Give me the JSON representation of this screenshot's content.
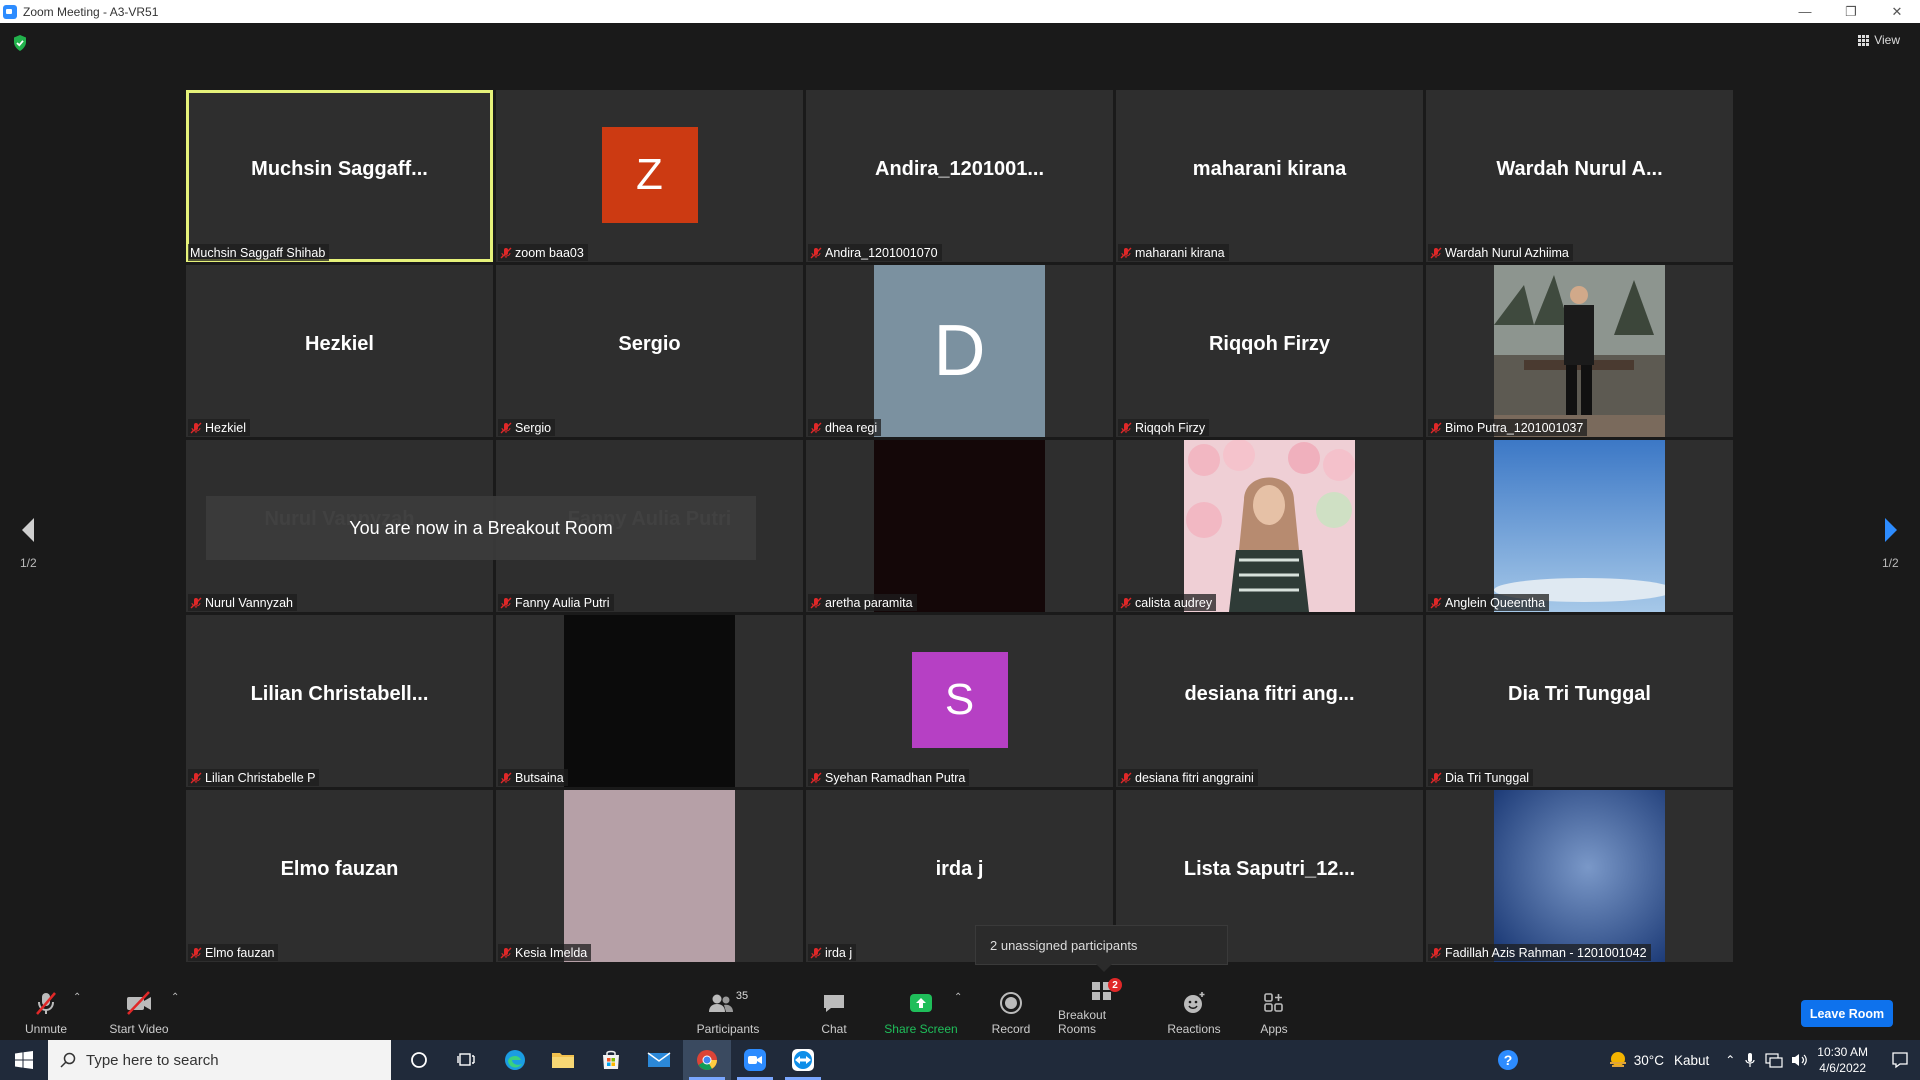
{
  "window": {
    "title": "Zoom Meeting - A3-VR51"
  },
  "top": {
    "view_label": "View"
  },
  "banner": {
    "text": "You are now in a Breakout Room"
  },
  "pager": {
    "left": "1/2",
    "right": "1/2"
  },
  "tiles": [
    {
      "big": "Muchsin  Saggaff...",
      "label": "Muchsin Saggaff Shihab",
      "muted": false,
      "active": true
    },
    {
      "avatar_letter": "Z",
      "avatar_color": "#cc3a12",
      "label": "zoom baa03",
      "muted": true
    },
    {
      "big": "Andira_1201001...",
      "label": "Andira_1201001070",
      "muted": true
    },
    {
      "big": "maharani kirana",
      "label": "maharani kirana",
      "muted": true
    },
    {
      "big": "Wardah  Nurul  A...",
      "label": "Wardah Nurul Azhiima",
      "muted": true
    },
    {
      "big": "Hezkiel",
      "label": "Hezkiel",
      "muted": true
    },
    {
      "big": "Sergio",
      "label": "Sergio",
      "muted": true
    },
    {
      "avatar_letter": "D",
      "avatar_color": "#7b91a0",
      "label": "dhea regi",
      "muted": true
    },
    {
      "big": "Riqqoh Firzy",
      "label": "Riqqoh Firzy",
      "muted": true
    },
    {
      "video": "person-outdoor",
      "label": "Bimo Putra_1201001037",
      "muted": true
    },
    {
      "big": "Nurul  Vannyzah",
      "label": "Nurul Vannyzah",
      "muted": true
    },
    {
      "big": "Fanny  Aulia Putri",
      "label": "Fanny Aulia Putri",
      "muted": true
    },
    {
      "video": "dark",
      "label": "aretha paramita",
      "muted": true
    },
    {
      "video": "person-pink",
      "label": "calista audrey",
      "muted": true
    },
    {
      "video": "sky",
      "label": "Anglein Queentha",
      "muted": true
    },
    {
      "big": "Lilian  Christabell...",
      "label": "Lilian Christabelle P",
      "muted": true
    },
    {
      "video": "black",
      "label": "Butsaina",
      "muted": true
    },
    {
      "avatar_letter": "S",
      "avatar_color": "#b640c4",
      "label": "Syehan Ramadhan Putra",
      "muted": true
    },
    {
      "big": "desiana  fitri  ang...",
      "label": "desiana fitri anggraini",
      "muted": true
    },
    {
      "big": "Dia Tri Tunggal",
      "label": "Dia Tri Tunggal",
      "muted": true
    },
    {
      "big": "Elmo fauzan",
      "label": "Elmo fauzan",
      "muted": true
    },
    {
      "video": "mauve",
      "label": "Kesia Imelda",
      "muted": true
    },
    {
      "big": "irda j",
      "label": "irda j",
      "muted": true
    },
    {
      "big": "Lista  Saputri_12...",
      "label": "01001035",
      "muted": false
    },
    {
      "video": "blue-blur",
      "label": "Fadillah Azis Rahman - 1201001042",
      "muted": true
    }
  ],
  "tooltip": {
    "text": "2 unassigned participants"
  },
  "toolbar": {
    "unmute": "Unmute",
    "start_video": "Start Video",
    "participants": "Participants",
    "participants_count": "35",
    "chat": "Chat",
    "share_screen": "Share Screen",
    "record": "Record",
    "breakout_rooms": "Breakout Rooms",
    "breakout_badge": "2",
    "reactions": "Reactions",
    "apps": "Apps",
    "leave": "Leave Room"
  },
  "taskbar": {
    "search_placeholder": "Type here to search",
    "temperature": "30°C",
    "weather": "Kabut",
    "time": "10:30 AM",
    "date": "4/6/2022"
  },
  "colors": {
    "accent": "#0e72ed",
    "active_speaker": "#e6f27a",
    "share_green": "#1fbe5a",
    "muted_red": "#e02828"
  }
}
